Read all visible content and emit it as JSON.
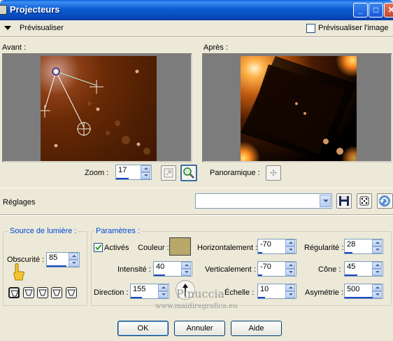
{
  "window": {
    "title": "Projecteurs"
  },
  "preview": {
    "toggle_label": "Prévisualiser",
    "preview_image_label": "Prévisualiser l'image",
    "preview_image_checked": false,
    "before_label": "Avant :",
    "after_label": "Après :"
  },
  "zoom": {
    "label": "Zoom :",
    "value": "17"
  },
  "panoramique": {
    "label": "Panoramique :"
  },
  "reglages": {
    "label": "Réglages",
    "preset_value": ""
  },
  "source": {
    "title": "Source de lumière :",
    "obscurite_label": "Obscurité :",
    "obscurite_value": "85",
    "light_number": "1"
  },
  "parametres": {
    "title": "Paramètres :",
    "actives_label": "Activés",
    "actives_checked": true,
    "couleur_label": "Couleur :",
    "couleur_value": "#b8a96a",
    "intensite_label": "Intensité :",
    "intensite_value": "40",
    "direction_label": "Direction :",
    "direction_value": "155",
    "horizontalement_label": "Horizontalement :",
    "horizontalement_value": "-70",
    "verticalement_label": "Verticalement :",
    "verticalement_value": "-70",
    "echelle_label": "Échelle :",
    "echelle_value": "10",
    "regularite_label": "Régularité :",
    "regularite_value": "28",
    "cone_label": "Cône :",
    "cone_value": "45",
    "asymetrie_label": "Asymétrie :",
    "asymetrie_value": "500"
  },
  "buttons": {
    "ok": "OK",
    "annuler": "Annuler",
    "aide": "Aide"
  },
  "watermark": {
    "line1": "Pinuccia",
    "line2": "www.maidiregrafica.eu"
  }
}
